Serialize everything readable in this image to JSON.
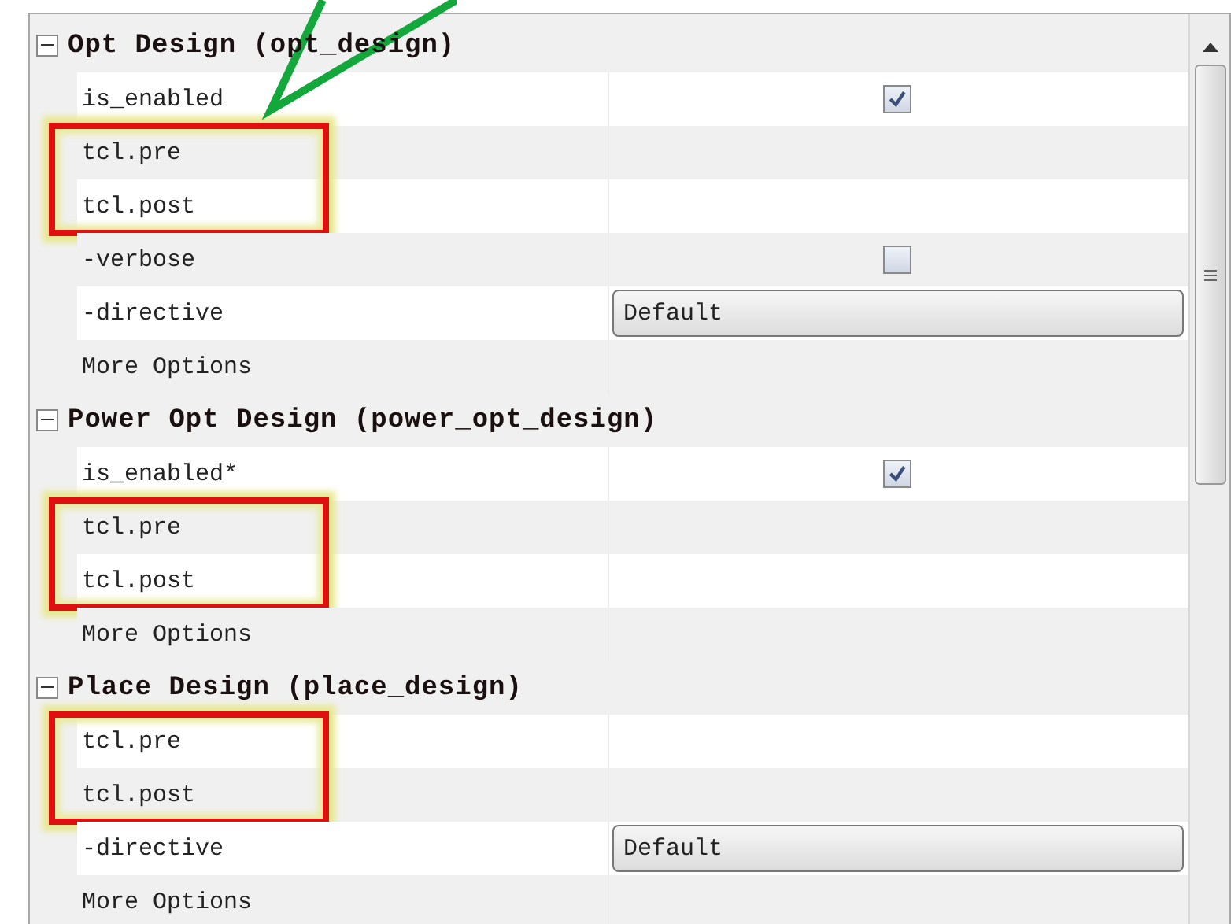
{
  "sections": [
    {
      "title": "Opt Design (opt_design)",
      "expanded": true,
      "rows": [
        {
          "label": "is_enabled",
          "kind": "checkbox",
          "checked": true,
          "highlighted": false
        },
        {
          "label": "tcl.pre",
          "kind": "text",
          "highlighted": true
        },
        {
          "label": "tcl.post",
          "kind": "text",
          "highlighted": true
        },
        {
          "label": "-verbose",
          "kind": "checkbox",
          "checked": false,
          "highlighted": false
        },
        {
          "label": "-directive",
          "kind": "dropdown",
          "value": "Default",
          "highlighted": false
        },
        {
          "label": "More Options",
          "kind": "text",
          "highlighted": false
        }
      ]
    },
    {
      "title": "Power Opt Design (power_opt_design)",
      "expanded": true,
      "rows": [
        {
          "label": "is_enabled*",
          "kind": "checkbox",
          "checked": true,
          "highlighted": false
        },
        {
          "label": "tcl.pre",
          "kind": "text",
          "highlighted": true
        },
        {
          "label": "tcl.post",
          "kind": "text",
          "highlighted": true
        },
        {
          "label": "More Options",
          "kind": "text",
          "highlighted": false
        }
      ]
    },
    {
      "title": "Place Design (place_design)",
      "expanded": true,
      "rows": [
        {
          "label": "tcl.pre",
          "kind": "text",
          "highlighted": true
        },
        {
          "label": "tcl.post",
          "kind": "text",
          "highlighted": true
        },
        {
          "label": "-directive",
          "kind": "dropdown",
          "value": "Default",
          "highlighted": false
        },
        {
          "label": "More Options",
          "kind": "text",
          "highlighted": false
        }
      ]
    }
  ]
}
